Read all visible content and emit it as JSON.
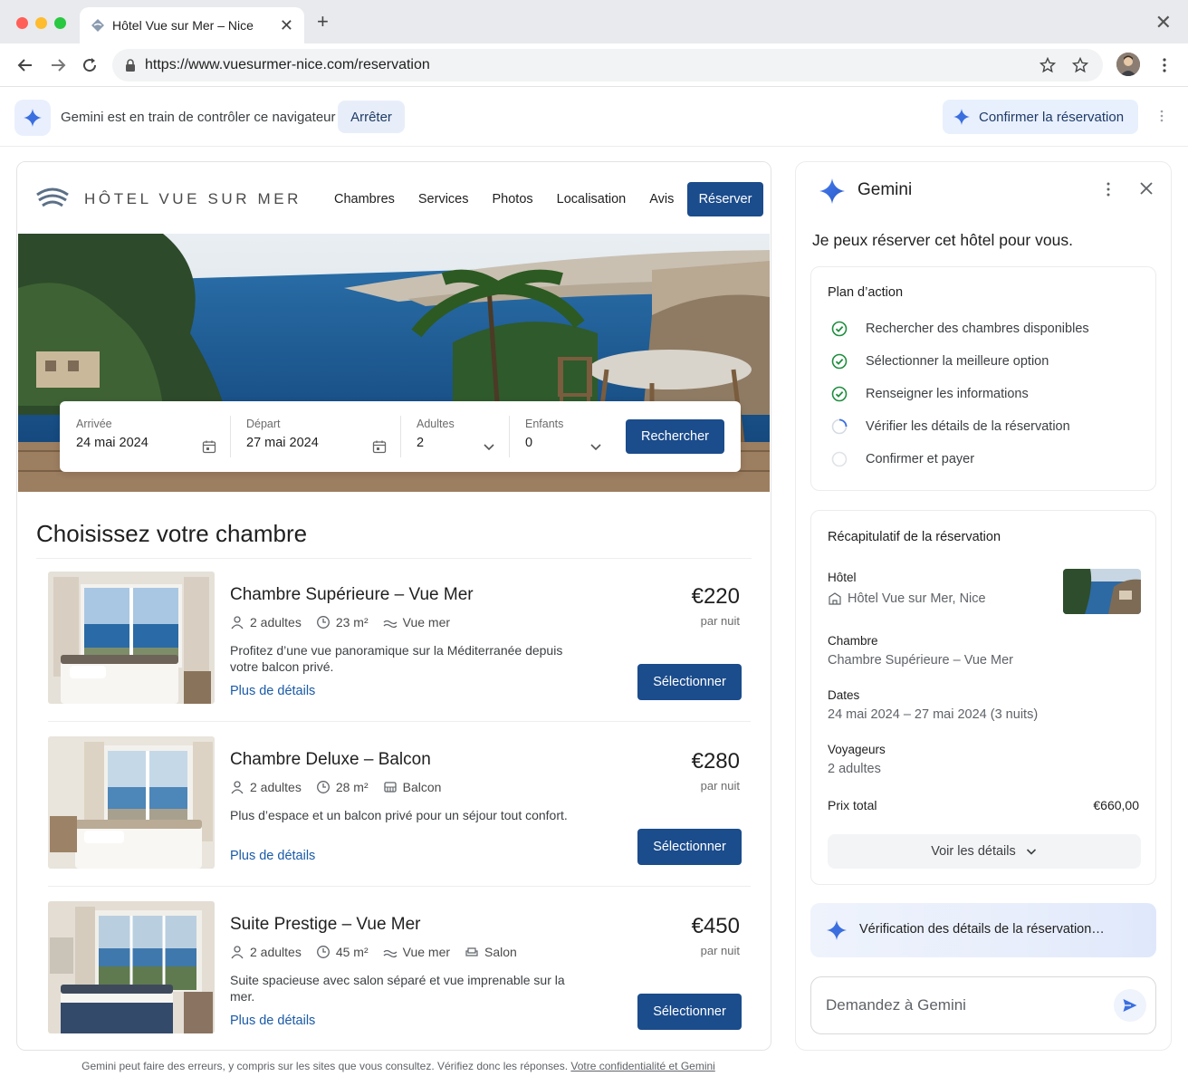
{
  "browser": {
    "tab_title": "Hôtel Vue sur Mer – Nice",
    "url": "https://www.vuesurmer-nice.com/reservation"
  },
  "gemini_bar": {
    "status_text": "Gemini est en train de contrôler ce navigateur",
    "stop_label": "Arrêter",
    "confirm_label": "Confirmer la réservation"
  },
  "site": {
    "logo_text": "HÔTEL VUE SUR MER",
    "nav": [
      "Chambres",
      "Services",
      "Photos",
      "Localisation",
      "Avis"
    ],
    "reserve_label": "Réserver",
    "search": {
      "arrival_label": "Arrivée",
      "arrival_value": "24 mai 2024",
      "departure_label": "Départ",
      "departure_value": "27 mai 2024",
      "adults_label": "Adultes",
      "adults_value": "2",
      "children_label": "Enfants",
      "children_value": "0",
      "search_label": "Rechercher"
    },
    "section_title": "Choisissez votre chambre",
    "rooms": [
      {
        "name": "Chambre Supérieure – Vue Mer",
        "guests": "2 adultes",
        "size": "23 m²",
        "feature1": "Vue mer",
        "description": "Profitez d’une vue panoramique sur la Méditerranée depuis votre balcon privé.",
        "link": "Plus de détails",
        "price": "€220",
        "unit": "par nuit",
        "select": "Sélectionner"
      },
      {
        "name": "Chambre Deluxe – Balcon",
        "guests": "2 adultes",
        "size": "28 m²",
        "feature1": "Balcon",
        "description": "Plus d’espace et un balcon privé pour un séjour tout confort.",
        "link": "Plus de détails",
        "price": "€280",
        "unit": "par nuit",
        "select": "Sélectionner"
      },
      {
        "name": "Suite Prestige – Vue Mer",
        "guests": "2 adultes",
        "size": "45 m²",
        "feature1": "Vue mer",
        "feature2": "Salon",
        "description": "Suite spacieuse avec salon séparé et vue imprenable sur la mer.",
        "link": "Plus de détails",
        "price": "€450",
        "unit": "par nuit",
        "select": "Sélectionner"
      }
    ]
  },
  "panel": {
    "title": "Gemini",
    "intro": "Je peux réserver cet hôtel pour vous.",
    "plan_title": "Plan d’action",
    "steps": [
      {
        "label": "Rechercher des chambres disponibles",
        "status": "done"
      },
      {
        "label": "Sélectionner la meilleure option",
        "status": "done"
      },
      {
        "label": "Renseigner les informations",
        "status": "done"
      },
      {
        "label": "Vérifier les détails de la réservation",
        "status": "in-progress"
      },
      {
        "label": "Confirmer et payer",
        "status": "pending"
      }
    ],
    "summary": {
      "title": "Récapitulatif de la réservation",
      "hotel_label": "Hôtel",
      "hotel_value": "Hôtel Vue sur Mer, Nice",
      "room_label": "Chambre",
      "room_value": "Chambre Supérieure – Vue Mer",
      "dates_label": "Dates",
      "dates_value": "24 mai 2024 – 27 mai 2024 (3 nuits)",
      "travelers_label": "Voyageurs",
      "travelers_value": "2 adultes",
      "total_label": "Prix total",
      "total_value": "€660,00",
      "details_label": "Voir les détails"
    },
    "status_text": "Vérification des détails de la réservation…",
    "ask_placeholder": "Demandez à Gemini"
  },
  "footer": {
    "note": "Gemini peut faire des erreurs, y compris sur les sites que vous consultez. Vérifiez donc les réponses.",
    "link": "Votre confidentialité et Gemini"
  },
  "colors": {
    "primary": "#1b4c8c",
    "gemini_blue": "#3b6fe0",
    "success": "#1e8e3e",
    "link": "#1a5aa8"
  }
}
